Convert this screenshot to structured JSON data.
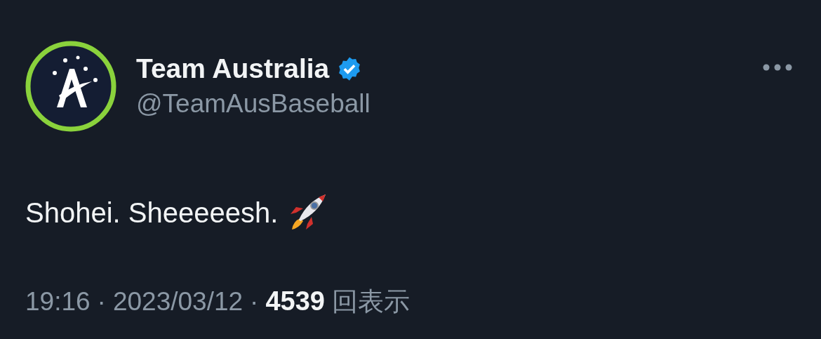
{
  "author": {
    "name": "Team Australia",
    "verified": true,
    "handle": "@TeamAusBaseball"
  },
  "text": "Shohei. Sheeeeesh.",
  "footer": [
    {
      "kind": "meta",
      "text": "19:16"
    },
    {
      "kind": "meta",
      "text": "·"
    },
    {
      "kind": "meta",
      "text": "2023/03/12"
    },
    {
      "kind": "meta",
      "text": "·"
    },
    {
      "kind": "count",
      "text": "4539"
    },
    {
      "kind": "meta",
      "text": "回表示"
    }
  ]
}
